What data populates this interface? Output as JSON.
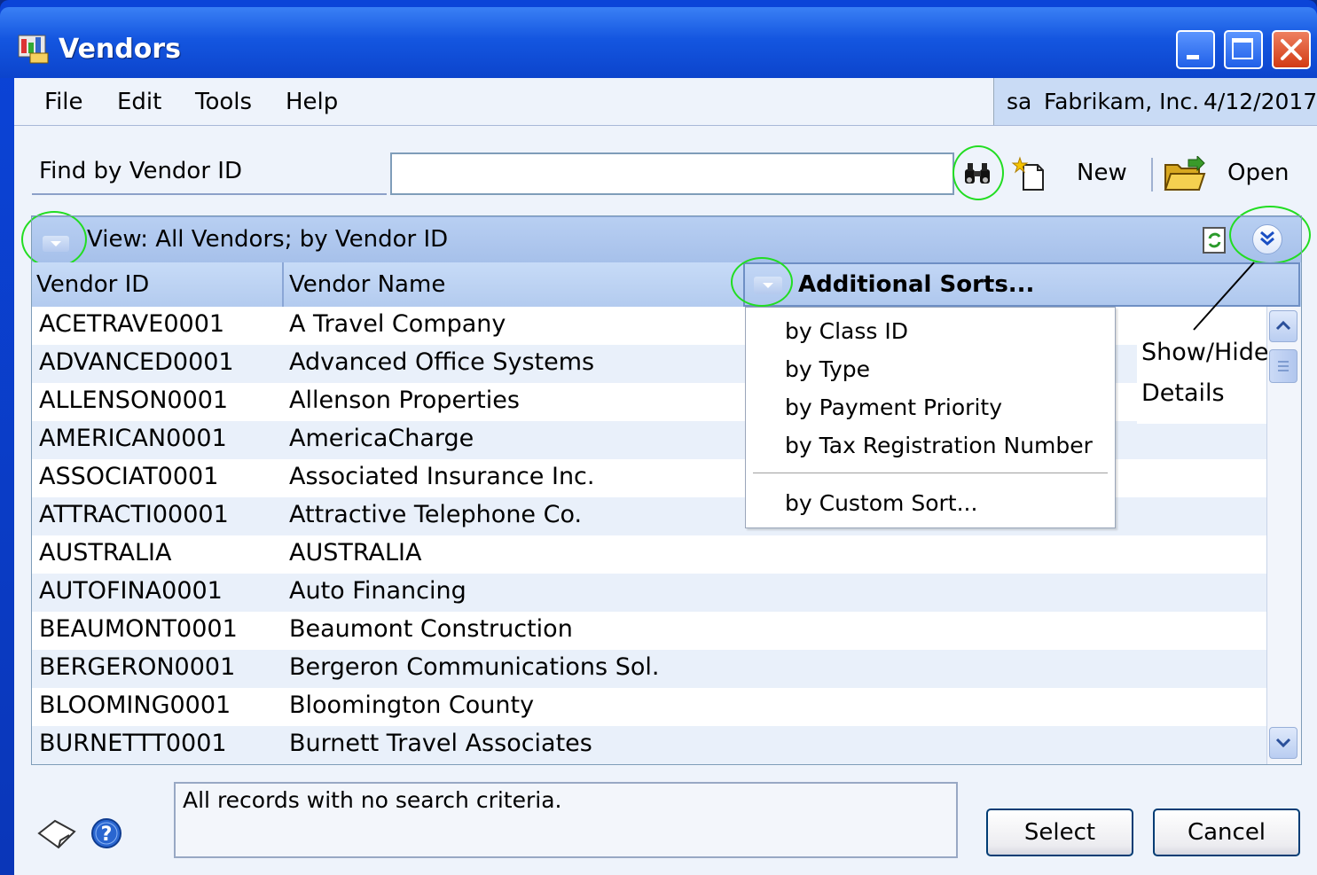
{
  "window": {
    "title": "Vendors"
  },
  "menu": {
    "file": "File",
    "edit": "Edit",
    "tools": "Tools",
    "help": "Help"
  },
  "user_info": {
    "user": "sa",
    "company": "Fabrikam, Inc.",
    "date": "4/12/2017"
  },
  "find": {
    "label": "Find by Vendor ID",
    "value": ""
  },
  "toolbar": {
    "new_label": "New",
    "open_label": "Open"
  },
  "view": {
    "label": "View: All Vendors; by Vendor ID"
  },
  "columns": {
    "vendor_id": "Vendor ID",
    "vendor_name": "Vendor Name",
    "additional_sorts": "Additional Sorts..."
  },
  "rows": [
    {
      "id": "ACETRAVE0001",
      "name": "A Travel Company"
    },
    {
      "id": "ADVANCED0001",
      "name": "Advanced Office Systems"
    },
    {
      "id": "ALLENSON0001",
      "name": "Allenson Properties"
    },
    {
      "id": "AMERICAN0001",
      "name": "AmericaCharge"
    },
    {
      "id": "ASSOCIAT0001",
      "name": "Associated Insurance Inc."
    },
    {
      "id": "ATTRACTI00001",
      "name": "Attractive Telephone Co."
    },
    {
      "id": "AUSTRALIA",
      "name": "AUSTRALIA"
    },
    {
      "id": "AUTOFINA0001",
      "name": "Auto Financing"
    },
    {
      "id": "BEAUMONT0001",
      "name": "Beaumont Construction"
    },
    {
      "id": "BERGERON0001",
      "name": "Bergeron Communications Sol."
    },
    {
      "id": "BLOOMING0001",
      "name": "Bloomington County"
    },
    {
      "id": "BURNETTT0001",
      "name": "Burnett Travel Associates"
    }
  ],
  "sort_menu": {
    "items": [
      "by Class ID",
      "by  Type",
      "by Payment Priority",
      "by Tax Registration Number"
    ],
    "custom": "by Custom Sort..."
  },
  "callout": {
    "line1": "Show/Hide",
    "line2": "Details"
  },
  "status": {
    "text": "All records with no search criteria."
  },
  "buttons": {
    "select": "Select",
    "cancel": "Cancel"
  }
}
